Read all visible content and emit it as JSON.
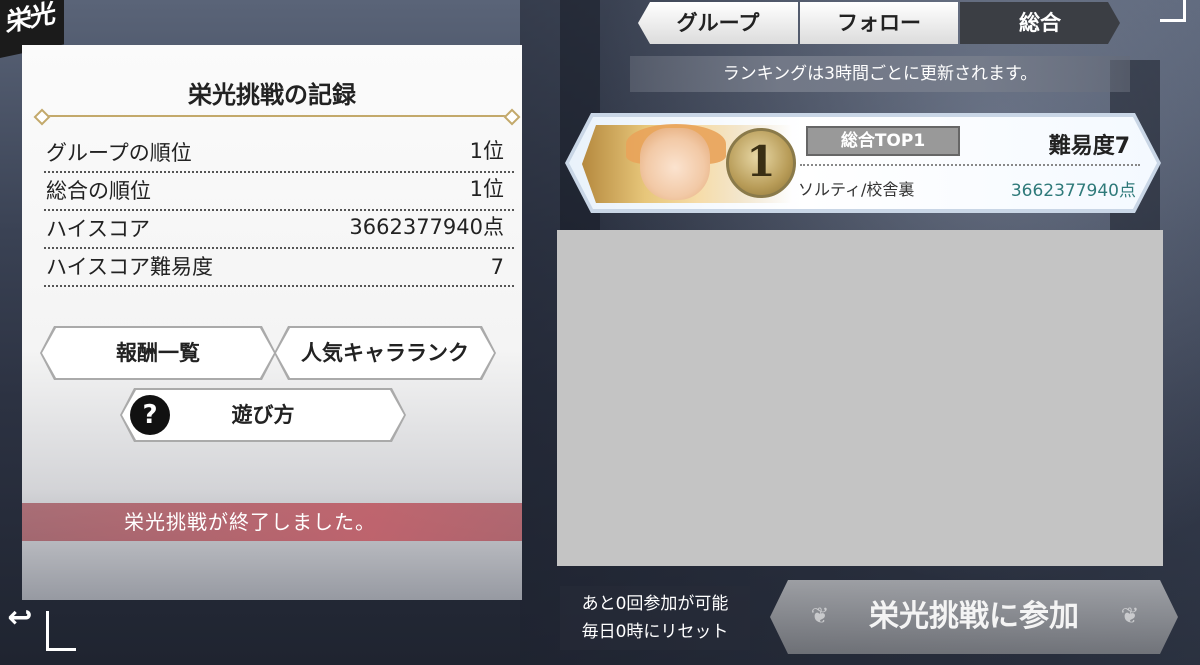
{
  "header": {
    "logo_text": "栄光"
  },
  "record_panel": {
    "title": "栄光挑戦の記録",
    "stats": [
      {
        "label": "グループの順位",
        "value": "1位"
      },
      {
        "label": "総合の順位",
        "value": "1位"
      },
      {
        "label": "ハイスコア",
        "value": "3662377940点"
      },
      {
        "label": "ハイスコア難易度",
        "value": "7"
      }
    ],
    "buttons": {
      "rewards": "報酬一覧",
      "popular": "人気キャラランク",
      "howto": "遊び方",
      "howto_icon": "?"
    },
    "ended_message": "栄光挑戦が終了しました。"
  },
  "tabs": [
    {
      "label": "グループ",
      "active": false
    },
    {
      "label": "フォロー",
      "active": false
    },
    {
      "label": "総合",
      "active": true
    }
  ],
  "notice": "ランキングは3時間ごとに更新されます。",
  "top_entry": {
    "rank": "1",
    "badge": "総合TOP1",
    "difficulty": "難易度7",
    "character": "ソルティ/校舎裏",
    "score": "3662377940点"
  },
  "footer": {
    "attempts_line1": "あと0回参加が可能",
    "attempts_line2": "毎日0時にリセット",
    "join_label": "栄光挑戦に参加",
    "back_icon": "↩"
  },
  "colors": {
    "accent_gold": "#c3a96b",
    "active_tab": "#3b3e44",
    "banner_red": "#b45a64",
    "score_teal": "#2f7a7a"
  }
}
